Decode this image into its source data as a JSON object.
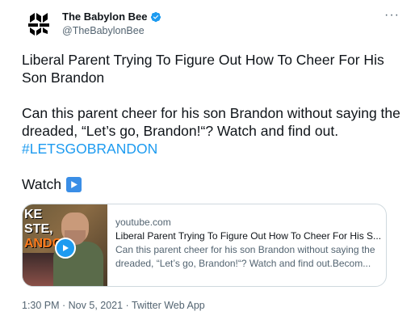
{
  "author": {
    "name": "The Babylon Bee",
    "handle": "@TheBabylonBee",
    "verified": true
  },
  "tweet": {
    "headline": "Liberal Parent Trying To Figure Out How To Cheer For His Son Brandon",
    "text": "Can this parent cheer for his son Brandon without saying the dreaded, “Let’s go, Brandon!“? Watch and find out.",
    "hashtag": "#LETSGOBRANDON",
    "watch_label": "Watch",
    "watch_emoji": "play-button-emoji"
  },
  "card": {
    "domain": "youtube.com",
    "title": "Liberal Parent Trying To Figure Out How To Cheer For His S...",
    "description": "Can this parent cheer for his son Brandon without saying the dreaded, “Let’s go, Brandon!“? Watch and find out.Becom...",
    "thumbnail_text_line1": "KE",
    "thumbnail_text_line2": "STE,",
    "thumbnail_text_line3": "ANDO",
    "has_video_play": true
  },
  "meta": {
    "timestamp": "1:30 PM · Nov 5, 2021 · Twitter Web App"
  },
  "colors": {
    "accent": "#1d9bf0",
    "text": "#0f1419",
    "muted": "#536471",
    "border": "#cfd9de"
  },
  "icons": {
    "avatar": "babylon-bee-logo-icon",
    "verified": "verified-badge-icon",
    "more": "more-options-icon",
    "play": "play-icon"
  }
}
